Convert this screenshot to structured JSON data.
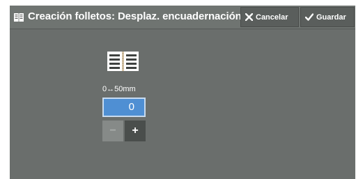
{
  "header": {
    "title": "Creación folletos: Desplaz. encuadernación",
    "title_icon": "booklet-icon",
    "cancel_label": "Cancelar",
    "cancel_icon": "close-icon",
    "save_label": "Guardar",
    "save_icon": "checkmark-icon"
  },
  "main": {
    "preview_icon": "open-booklet-icon",
    "range_label": "0↔50mm",
    "value": "0",
    "decrement_label": "−",
    "increment_label": "+"
  },
  "colors": {
    "titlebar": "#6f7471",
    "content_bg": "#6a6e6c",
    "value_box": "#4f8fd3"
  }
}
